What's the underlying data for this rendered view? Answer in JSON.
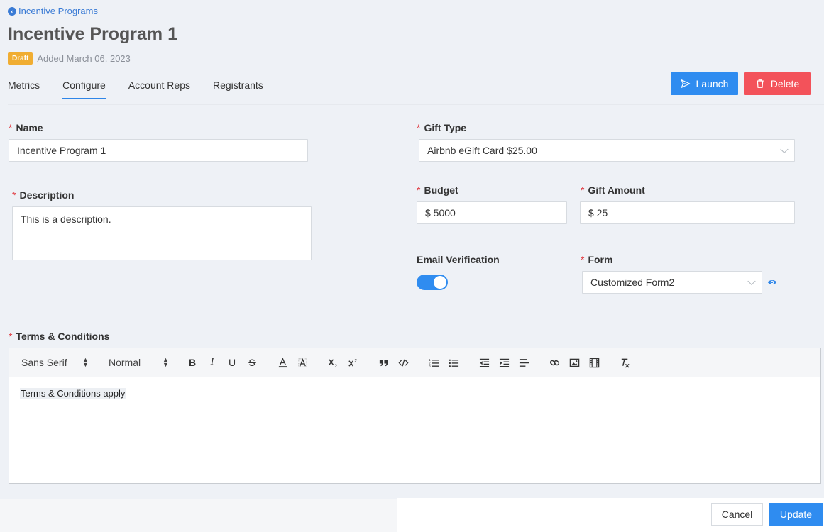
{
  "header": {
    "back_label": "Incentive Programs",
    "title": "Incentive Program 1",
    "status_badge": "Draft",
    "added_text": "Added March 06, 2023"
  },
  "tabs": [
    {
      "label": "Metrics",
      "active": false
    },
    {
      "label": "Configure",
      "active": true
    },
    {
      "label": "Account Reps",
      "active": false
    },
    {
      "label": "Registrants",
      "active": false
    }
  ],
  "actions": {
    "launch_label": "Launch",
    "delete_label": "Delete"
  },
  "form": {
    "name": {
      "label": "Name",
      "value": "Incentive Program 1",
      "required": true
    },
    "description": {
      "label": "Description",
      "value": "This is a description.",
      "required": true
    },
    "gift_type": {
      "label": "Gift Type",
      "value": "Airbnb eGift Card $25.00",
      "required": true
    },
    "budget": {
      "label": "Budget",
      "value": "$ 5000",
      "required": true
    },
    "gift_amount": {
      "label": "Gift Amount",
      "value": "$ 25",
      "required": true
    },
    "email_verification": {
      "label": "Email Verification",
      "enabled": true
    },
    "form_select": {
      "label": "Form",
      "value": "Customized Form2",
      "required": true
    },
    "terms": {
      "label": "Terms & Conditions",
      "required": true
    }
  },
  "editor": {
    "font_family": "Sans Serif",
    "font_size": "Normal",
    "content": "Terms & Conditions apply"
  },
  "footer": {
    "cancel_label": "Cancel",
    "update_label": "Update"
  },
  "colors": {
    "primary": "#2f8cf0",
    "danger": "#f3525a",
    "draft": "#f0ad32",
    "required": "#e0383e"
  }
}
